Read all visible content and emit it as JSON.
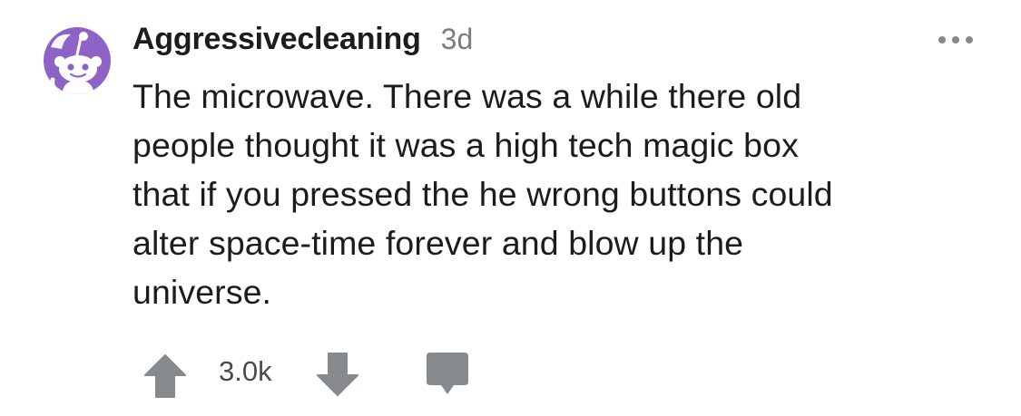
{
  "comment": {
    "username": "Aggressivecleaning",
    "timestamp": "3d",
    "body_lines": [
      "The microwave. There was a while there old",
      "people thought it was a high tech magic box",
      "that if you pressed the he wrong buttons could",
      "alter space-time forever and blow up the",
      "universe."
    ],
    "score": "3.0k"
  },
  "icons": {
    "avatar": "snoo-avatar-icon",
    "more": "more-options-icon",
    "upvote": "upvote-arrow-icon",
    "downvote": "downvote-arrow-icon",
    "reply": "comment-bubble-icon"
  },
  "colors": {
    "avatar_bg": "#8e63c7",
    "icon_gray": "#878a8c",
    "meta_gray": "#7c7c7c",
    "text": "#1c1c1c"
  }
}
